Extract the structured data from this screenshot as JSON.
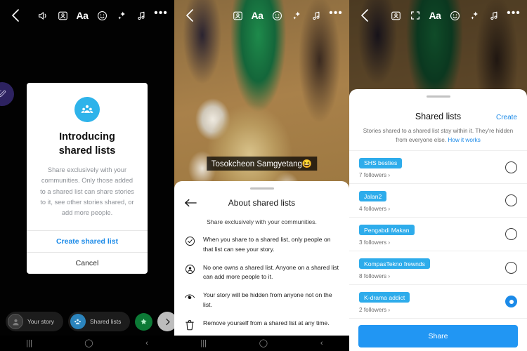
{
  "panel1": {
    "toolbar": {
      "back": "back-arrow",
      "icons": [
        "volume-icon",
        "person-card-icon",
        "text-icon",
        "sticker-icon",
        "sparkle-icon",
        "music-icon",
        "more-icon"
      ],
      "text_icon_label": "Aa",
      "more_label": "•••"
    },
    "dialog": {
      "title_line1": "Introducing",
      "title_line2": "shared lists",
      "description": "Share exclusively with your communities. Only those added to a shared list can share stories to it, see other stories shared, or add more people.",
      "primary_button": "Create shared list",
      "secondary_button": "Cancel"
    },
    "chips": [
      {
        "label": "Your story",
        "avatar": "story-avatar-icon"
      },
      {
        "label": "Shared lists",
        "avatar": "shared-lists-avatar-icon"
      }
    ],
    "green_button": "close-friends-icon",
    "next_button": "send-arrow-icon"
  },
  "panel2": {
    "toolbar": {
      "back": "back-arrow",
      "text_icon_label": "Aa",
      "more_label": "•••"
    },
    "caption": "Tosokcheon Samgyetang😆",
    "sheet": {
      "title": "About shared lists",
      "subtitle": "Share exclusively with your communities.",
      "bullets": [
        {
          "icon": "check-circle-icon",
          "text": "When you share to a shared list, only people on that list can see your story."
        },
        {
          "icon": "person-circle-icon",
          "text": "No one owns a shared list. Anyone on a shared list can add more people to it."
        },
        {
          "icon": "eye-hidden-icon",
          "text": "Your story will be hidden from anyone not on the list."
        },
        {
          "icon": "trash-icon",
          "text": "Remove yourself from a shared list at any time."
        }
      ]
    }
  },
  "panel3": {
    "toolbar": {
      "back": "back-arrow",
      "text_icon_label": "Aa",
      "more_label": "•••"
    },
    "sheet": {
      "title": "Shared lists",
      "create_label": "Create",
      "description_part1": "Stories shared to a shared list stay within it. They're hidden from everyone else. ",
      "description_link": "How it works",
      "lists": [
        {
          "name": "SHS besties",
          "followers": "7 followers ›",
          "selected": false
        },
        {
          "name": "Jalan2",
          "followers": "4 followers ›",
          "selected": false
        },
        {
          "name": "Pengabdi Makan",
          "followers": "3 followers ›",
          "selected": false
        },
        {
          "name": "KompasTekno frewnds",
          "followers": "8 followers ›",
          "selected": false
        },
        {
          "name": "K-drama addict",
          "followers": "2 followers ›",
          "selected": true
        }
      ],
      "share_button": "Share"
    }
  },
  "navbar": {
    "recents": "|||",
    "home": "◯",
    "back": "‹"
  },
  "colors": {
    "accent": "#1b8ae8",
    "pill": "#2eaceb",
    "share": "#2196f3",
    "dialog_icon": "#2eb3ea"
  }
}
